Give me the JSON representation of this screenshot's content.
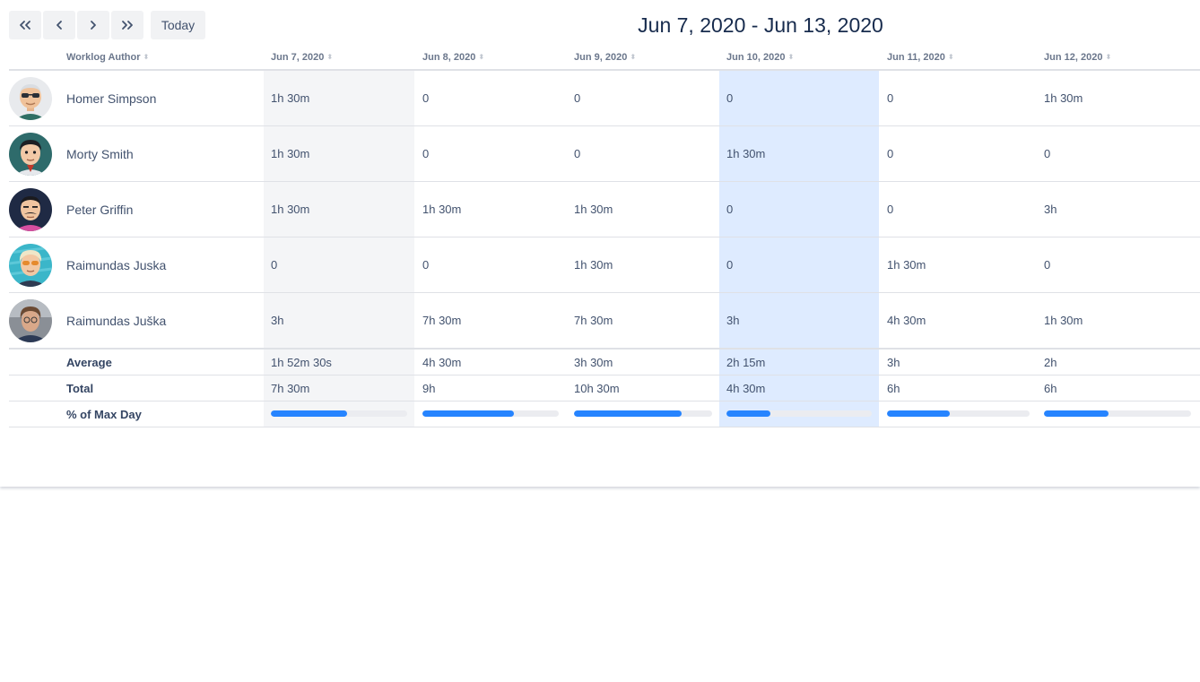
{
  "nav": {
    "today_label": "Today"
  },
  "range_title": "Jun 7, 2020 - Jun 13, 2020",
  "columns": {
    "author": "Worklog Author",
    "days": [
      "Jun 7, 2020",
      "Jun 8, 2020",
      "Jun 9, 2020",
      "Jun 10, 2020",
      "Jun 11, 2020",
      "Jun 12, 2020"
    ]
  },
  "rows": [
    {
      "name": "Homer Simpson",
      "avatar": "bald-man-sunglasses-avatar",
      "values": [
        "1h 30m",
        "0",
        "0",
        "0",
        "0",
        "1h 30m"
      ]
    },
    {
      "name": "Morty Smith",
      "avatar": "young-man-avatar",
      "values": [
        "1h 30m",
        "0",
        "0",
        "1h 30m",
        "0",
        "0"
      ]
    },
    {
      "name": "Peter Griffin",
      "avatar": "mustache-man-avatar",
      "values": [
        "1h 30m",
        "1h 30m",
        "1h 30m",
        "0",
        "0",
        "3h"
      ]
    },
    {
      "name": "Raimundas Juska",
      "avatar": "blonde-sunglasses-avatar",
      "values": [
        "0",
        "0",
        "1h 30m",
        "0",
        "1h 30m",
        "0"
      ]
    },
    {
      "name": "Raimundas Juška",
      "avatar": "photo-avatar",
      "values": [
        "3h",
        "7h 30m",
        "7h 30m",
        "3h",
        "4h 30m",
        "1h 30m"
      ]
    }
  ],
  "summary": {
    "average": {
      "label": "Average",
      "values": [
        "1h 52m 30s",
        "4h 30m",
        "3h 30m",
        "2h 15m",
        "3h",
        "2h"
      ]
    },
    "total": {
      "label": "Total",
      "values": [
        "7h 30m",
        "9h",
        "10h 30m",
        "4h 30m",
        "6h",
        "6h"
      ]
    },
    "max_day": {
      "label": "% of Max Day",
      "percent": [
        56,
        67,
        78,
        30,
        44,
        44
      ]
    }
  },
  "colors": {
    "today_column": "#deebff",
    "weekend_column": "#f4f5f7",
    "bar": "#2684ff",
    "track": "#ebecf0"
  }
}
